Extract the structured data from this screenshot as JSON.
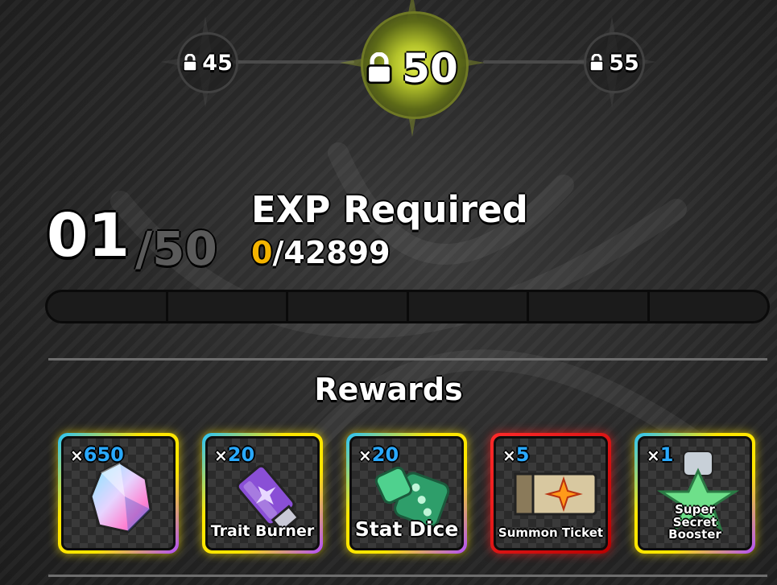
{
  "milestones": {
    "prev": {
      "level": "45",
      "icon": "lock-icon"
    },
    "current": {
      "level": "50",
      "icon": "lock-icon"
    },
    "next": {
      "level": "55",
      "icon": "lock-icon"
    }
  },
  "level": {
    "current": "01",
    "max": "/50"
  },
  "exp": {
    "title": "EXP Required",
    "current": "0",
    "required": "/42899",
    "progress_fraction": 0
  },
  "rewards": {
    "title": "Rewards",
    "items": [
      {
        "qty_prefix": "×",
        "qty": "650",
        "name": "",
        "icon": "crystal-gem-icon",
        "rarity_color": "#ffe600"
      },
      {
        "qty_prefix": "×",
        "qty": "20",
        "name": "Trait Burner",
        "icon": "trait-burner-usb-icon",
        "rarity_color": "#ffe600"
      },
      {
        "qty_prefix": "×",
        "qty": "20",
        "name": "Stat Dice",
        "icon": "dice-icon",
        "rarity_color": "#ffe600"
      },
      {
        "qty_prefix": "×",
        "qty": "5",
        "name": "Summon Ticket",
        "icon": "ticket-icon",
        "rarity_color": "#ff2a2a"
      },
      {
        "qty_prefix": "×",
        "qty": "1",
        "name": "Super Secret Booster",
        "icon": "booster-potion-icon",
        "rarity_color": "#ffe600"
      }
    ]
  },
  "colors": {
    "accent_gold": "#f4b400",
    "qty_blue": "#29a9ff",
    "active_glow": "#d6e63a"
  }
}
